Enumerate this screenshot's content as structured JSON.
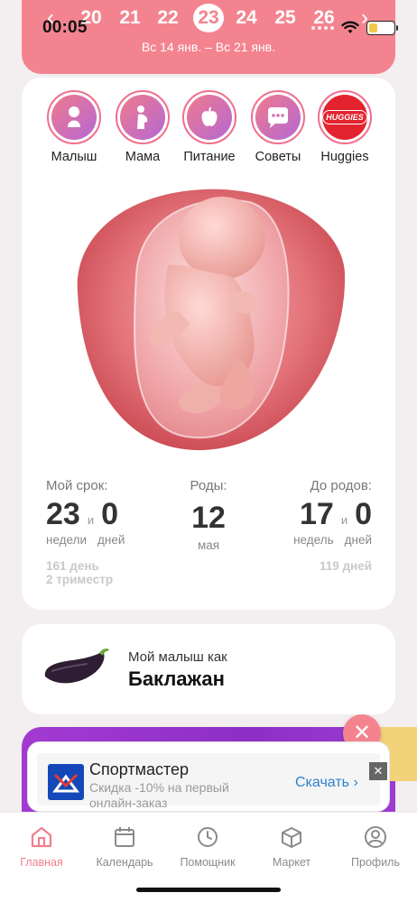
{
  "status": {
    "time": "00:05",
    "battery_level": 0.25
  },
  "header": {
    "weeks": [
      "20",
      "21",
      "22",
      "23",
      "24",
      "25",
      "26"
    ],
    "active_week": "23",
    "date_range": "Вс 14 янв. – Вс 21 янв.",
    "prev_icon": "chevron-left-icon",
    "next_icon": "chevron-right-icon",
    "color": "#f3848f"
  },
  "categories": [
    {
      "label": "Малыш",
      "icon": "baby-icon"
    },
    {
      "label": "Мама",
      "icon": "pregnant-woman-icon"
    },
    {
      "label": "Питание",
      "icon": "apple-icon"
    },
    {
      "label": "Советы",
      "icon": "chat-bubble-icon"
    },
    {
      "label": "Huggies",
      "icon": "huggies-logo",
      "logo_text": "HUGGIES"
    }
  ],
  "stats": {
    "term": {
      "title": "Мой срок:",
      "weeks": "23",
      "and": "и",
      "days": "0",
      "weeks_label": "недели",
      "days_label": "дней",
      "day_count": "161 день",
      "trimester": "2 триместр"
    },
    "birth": {
      "title": "Роды:",
      "day": "12",
      "month": "мая"
    },
    "remaining": {
      "title": "До родов:",
      "weeks": "17",
      "and": "и",
      "days": "0",
      "weeks_label": "недель",
      "days_label": "дней",
      "day_count": "119 дней"
    }
  },
  "baby_like": {
    "subtitle": "Мой малыш как",
    "title": "Баклажан",
    "icon": "eggplant-icon"
  },
  "ad": {
    "title": "Спортмастер",
    "text": "Скидка -10% на первый онлайн-заказ",
    "cta": "Скачать",
    "close": "✕"
  },
  "close_button": "✕",
  "tabs": [
    {
      "label": "Главная",
      "icon": "home-icon",
      "active": true
    },
    {
      "label": "Календарь",
      "icon": "calendar-icon",
      "active": false
    },
    {
      "label": "Помощник",
      "icon": "clock-icon",
      "active": false
    },
    {
      "label": "Маркет",
      "icon": "box-icon",
      "active": false
    },
    {
      "label": "Профиль",
      "icon": "profile-icon",
      "active": false
    }
  ],
  "colors": {
    "accent": "#f3848f",
    "tab_active": "#f07f8d",
    "promo": "#9b3cd0",
    "link": "#2f7fcf"
  }
}
